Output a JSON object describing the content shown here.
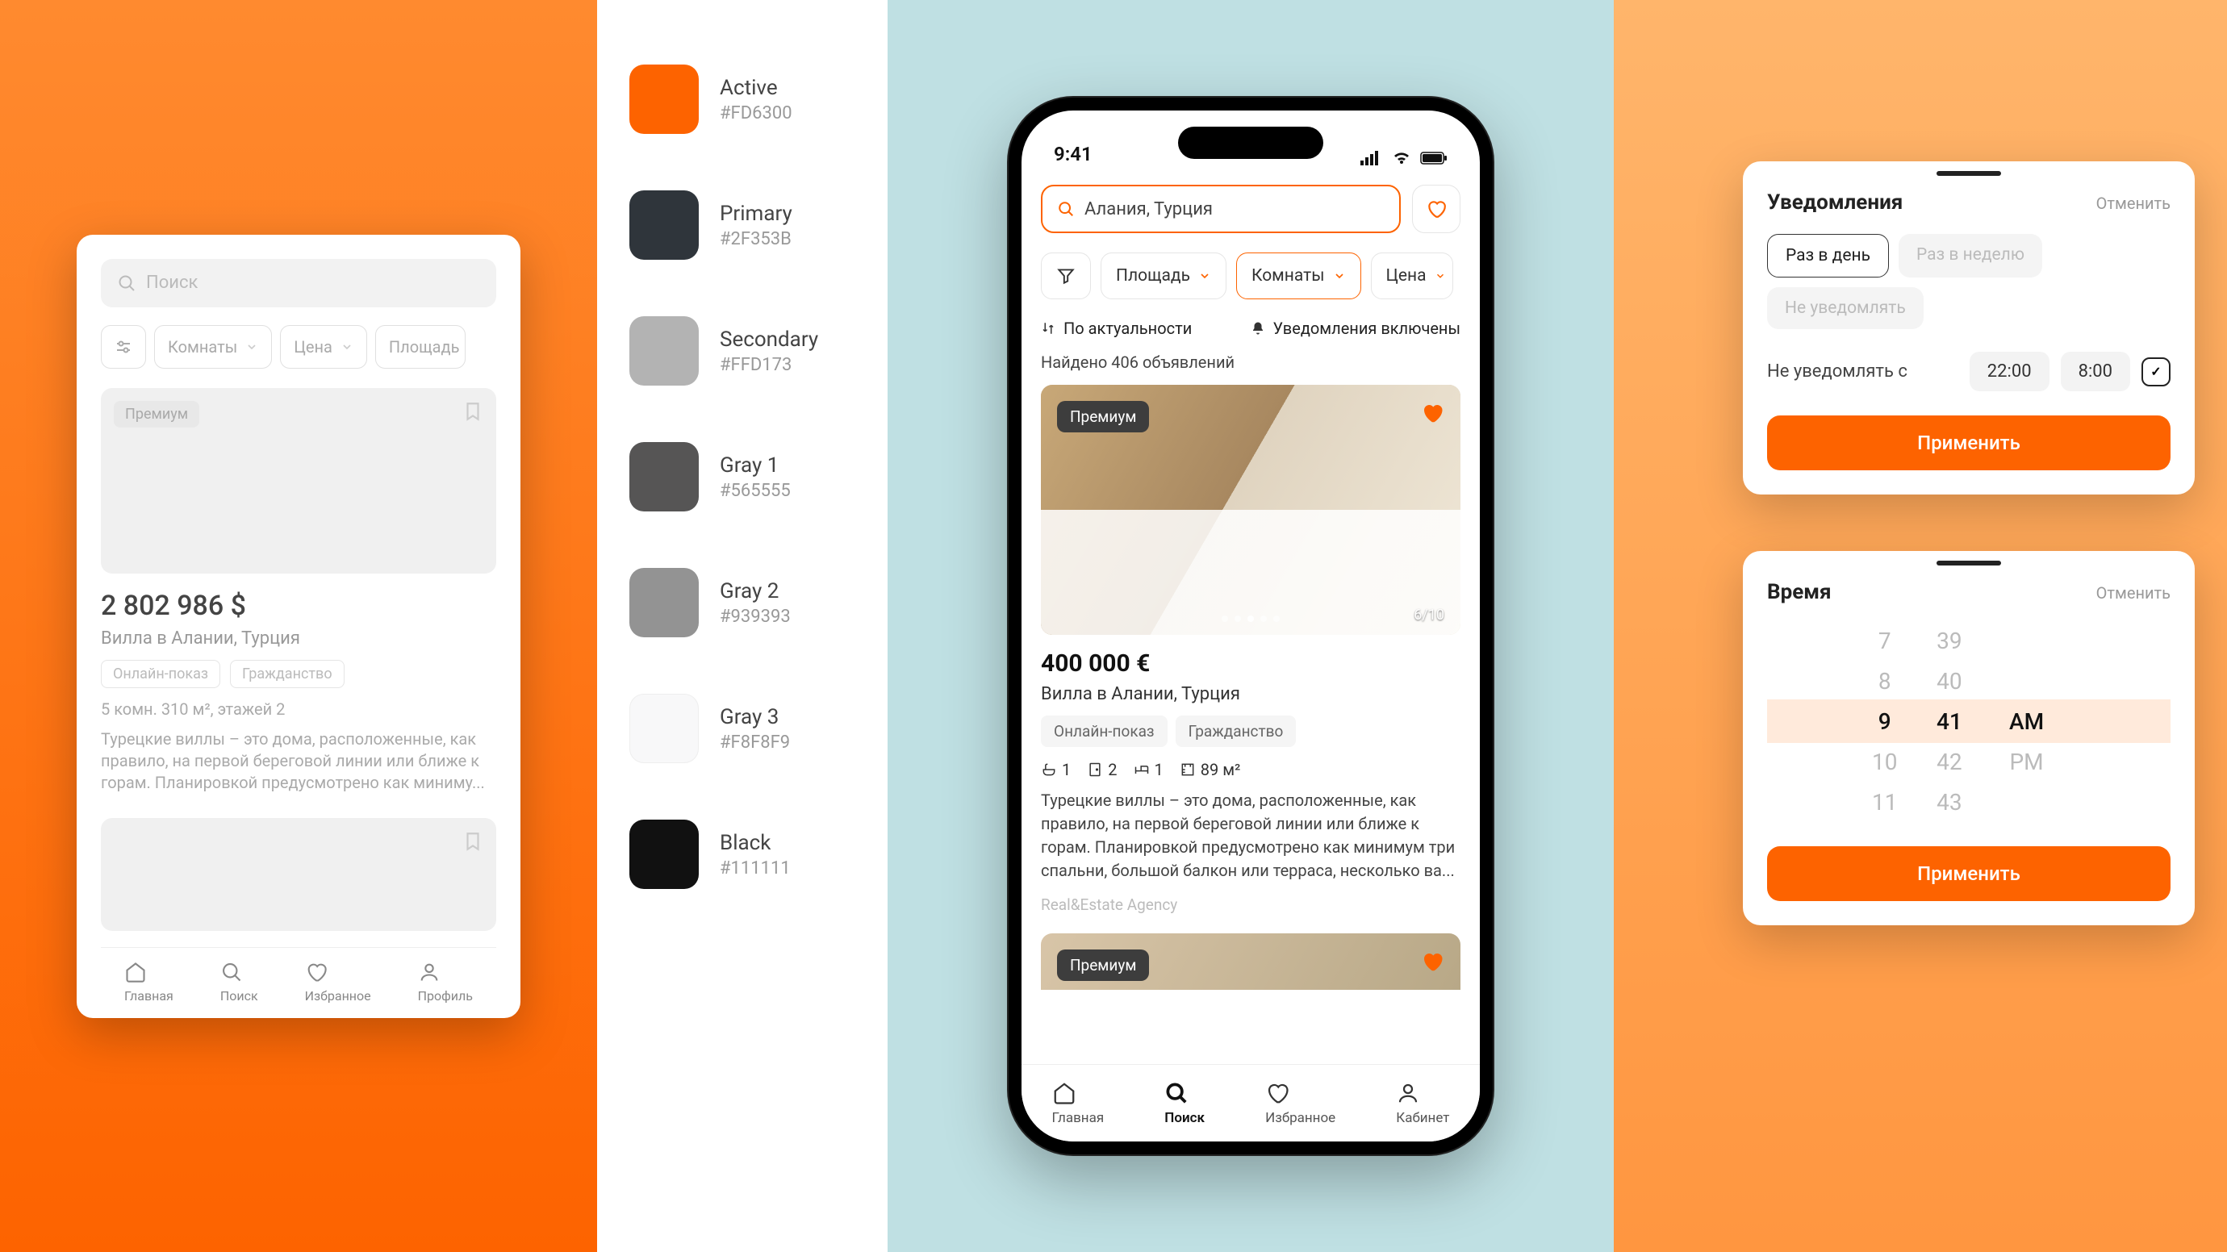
{
  "wireframe": {
    "search_placeholder": "Поиск",
    "filters": {
      "rooms": "Комнаты",
      "price": "Цена",
      "area": "Площадь"
    },
    "card": {
      "badge": "Премиум",
      "price": "2 802 986 $",
      "location": "Вилла в Алании, Турция",
      "tag_online": "Онлайн-показ",
      "tag_citizen": "Гражданство",
      "meta": "5 комн. 310 м², этажей 2",
      "desc": "Турецкие виллы – это дома, расположенные, как правило, на первой береговой линии или ближе к горам. Планировкой предусмотрено как миниму..."
    },
    "nav": {
      "home": "Главная",
      "search": "Поиск",
      "fav": "Избранное",
      "profile": "Профиль"
    }
  },
  "palette": [
    {
      "name": "Active",
      "hex": "#FD6300"
    },
    {
      "name": "Primary",
      "hex": "#2F353B"
    },
    {
      "name": "Secondary",
      "hex": "#FFD173"
    },
    {
      "name": "Gray 1",
      "hex": "#565555"
    },
    {
      "name": "Gray 2",
      "hex": "#939393"
    },
    {
      "name": "Gray 3",
      "hex": "#F8F8F9"
    },
    {
      "name": "Black",
      "hex": "#111111"
    }
  ],
  "phone": {
    "time": "9:41",
    "search_value": "Алания, Турция",
    "filters": {
      "area": "Площадь",
      "rooms": "Комнаты",
      "price": "Цена"
    },
    "sort": "По актуальности",
    "notif": "Уведомления включены",
    "found": "Найдено 406 объявлений",
    "listing": {
      "badge": "Премиум",
      "counter": "6/10",
      "price": "400 000 €",
      "location": "Вилла в Алании, Турция",
      "tag_online": "Онлайн-показ",
      "tag_citizen": "Гражданство",
      "beds": "1",
      "baths": "2",
      "rooms": "1",
      "area": "89 м²",
      "desc": "Турецкие виллы – это дома, расположенные, как правило, на первой береговой линии или ближе к горам. Планировкой предусмотрено как минимум три спальни, большой балкон или терраса, несколько ва...",
      "agency": "Real&Estate Agency"
    },
    "listing2_badge": "Премиум",
    "nav": {
      "home": "Главная",
      "search": "Поиск",
      "fav": "Избранное",
      "cabinet": "Кабинет"
    }
  },
  "sheet_notif": {
    "title": "Уведомления",
    "cancel": "Отменить",
    "opt_daily": "Раз в день",
    "opt_weekly": "Раз в неделю",
    "opt_never": "Не уведомлять",
    "dnd_label": "Не уведомлять с",
    "dnd_from": "22:00",
    "dnd_to": "8:00",
    "apply": "Применить"
  },
  "sheet_time": {
    "title": "Время",
    "cancel": "Отменить",
    "hours": [
      "7",
      "8",
      "9",
      "10",
      "11"
    ],
    "minutes": [
      "39",
      "40",
      "41",
      "42",
      "43"
    ],
    "ampm": [
      "AM",
      "PM"
    ],
    "apply": "Применить"
  }
}
